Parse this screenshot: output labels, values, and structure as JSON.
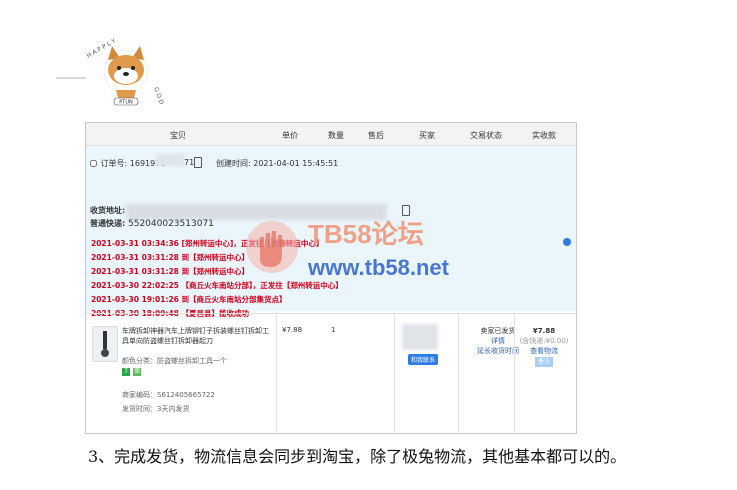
{
  "logo": {
    "letters_top": "HAPPLY",
    "letters_side": "GOD",
    "label": "PTUN"
  },
  "table_header": [
    "宝贝",
    "单价",
    "数量",
    "售后",
    "买家",
    "交易状态",
    "实收款"
  ],
  "order": {
    "order_no_label": "订单号: 1691976",
    "order_suffix": "71",
    "created": "创建时间: 2021-04-01 15:45:51",
    "address_label": "收货地址:",
    "express_label": "普通快递:",
    "express_no": "552040023513071",
    "tracking": [
      "2021-03-31 03:34:36  [郑州转运中心]，正发往【长春转运中心】",
      "2021-03-31 03:31:28 到【郑州转运中心】",
      "2021-03-31 03:31:28 到【郑州转运中心】",
      "2021-03-30 22:02:25 【商丘火车南站分部】，正发往【郑州转运中心】",
      "2021-03-30 19:01:26 到【商丘火车南站分部集货点】",
      "2021-03-30 18:09:48 【夏邑县】揽收成功"
    ]
  },
  "item": {
    "name": "车牌拆卸神器汽车上牌铆钉子拆装螺丝钉拆卸工具单向防盗螺丝钉拆卸器起刀",
    "color_prop": "颜色分类：防盗螺丝拆卸工具一个",
    "merchant_code": "商家编码：S612405665722",
    "ship_time": "发货时间：3天内发货",
    "unit_price": "¥7.88",
    "qty": "1",
    "contact": "和我联系",
    "status": "卖家已发货",
    "status_detail": "详情",
    "status_extend": "延长收货时间",
    "total": "¥7.88",
    "fee": "(含快递:¥0.00)",
    "logistics_link": "查看物流",
    "remark_btn": "备注"
  },
  "watermark": {
    "line1": "TB58论坛",
    "line2": "www.tb58.net"
  },
  "caption": "3、完成发货，物流信息会同步到淘宝，除了极兔物流，其他基本都可以的。"
}
